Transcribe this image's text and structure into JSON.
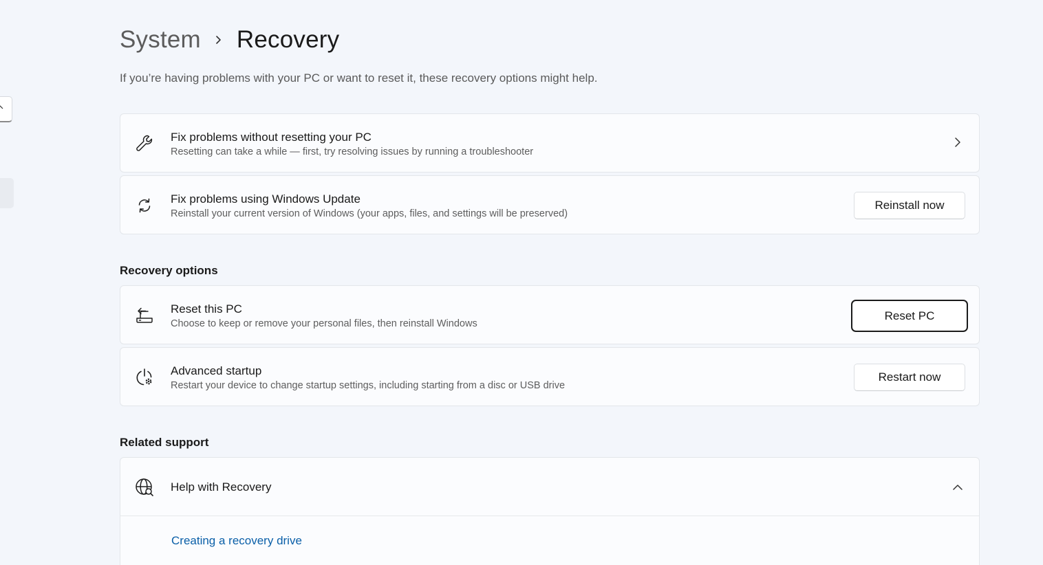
{
  "breadcrumb": {
    "parent": "System",
    "current": "Recovery"
  },
  "intro": "If you’re having problems with your PC or want to reset it, these recovery options might help.",
  "top_cards": [
    {
      "icon": "wrench-icon",
      "title": "Fix problems without resetting your PC",
      "description": "Resetting can take a while — first, try resolving issues by running a troubleshooter",
      "action": "chevron-right"
    },
    {
      "icon": "sync-icon",
      "title": "Fix problems using Windows Update",
      "description": "Reinstall your current version of Windows (your apps, files, and settings will be preserved)",
      "button": "Reinstall now"
    }
  ],
  "recovery_options": {
    "heading": "Recovery options",
    "items": [
      {
        "icon": "reset-pc-icon",
        "title": "Reset this PC",
        "description": "Choose to keep or remove your personal files, then reinstall Windows",
        "button": "Reset PC"
      },
      {
        "icon": "advanced-startup-icon",
        "title": "Advanced startup",
        "description": "Restart your device to change startup settings, including starting from a disc or USB drive",
        "button": "Restart now"
      }
    ]
  },
  "related_support": {
    "heading": "Related support",
    "item": {
      "icon": "globe-icon",
      "title": "Help with Recovery",
      "expanded": true,
      "links": [
        "Creating a recovery drive"
      ]
    }
  },
  "colors": {
    "background": "#f3f6fb",
    "card": "#fbfcfe",
    "link": "#0a5fa8"
  }
}
